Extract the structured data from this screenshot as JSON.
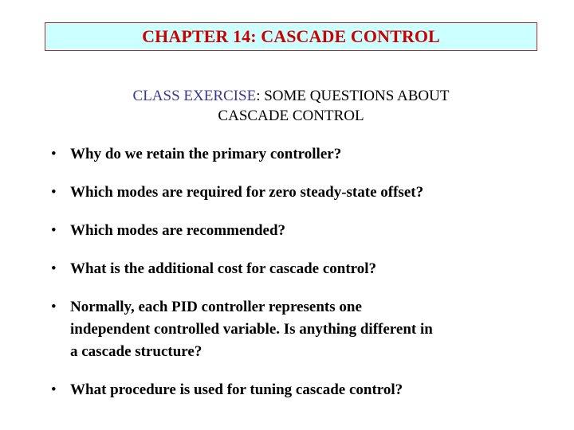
{
  "slide": {
    "title": "CHAPTER 14: CASCADE CONTROL",
    "title_box_fill": "#CCFFFF",
    "title_box_border": "#A03030",
    "title_color": "#CC0000",
    "background": "#FFFFFF",
    "subtitle": {
      "highlight": "CLASS EXERCISE",
      "highlight_color": "#3A3A8C",
      "rest_line1": ": SOME QUESTIONS ABOUT",
      "line2": "CASCADE CONTROL"
    },
    "bullet_glyph": "•",
    "bullets": [
      {
        "lines": [
          "Why do we retain the primary controller?"
        ]
      },
      {
        "lines": [
          "Which modes are required for zero steady-state offset?"
        ]
      },
      {
        "lines": [
          "Which modes are recommended?"
        ]
      },
      {
        "lines": [
          "What is the additional cost for cascade control?"
        ]
      },
      {
        "lines": [
          "Normally, each PID controller represents one",
          "independent controlled variable.  Is anything different in",
          "a cascade structure?"
        ]
      },
      {
        "lines": [
          "What procedure is used for tuning cascade control?"
        ]
      }
    ]
  }
}
